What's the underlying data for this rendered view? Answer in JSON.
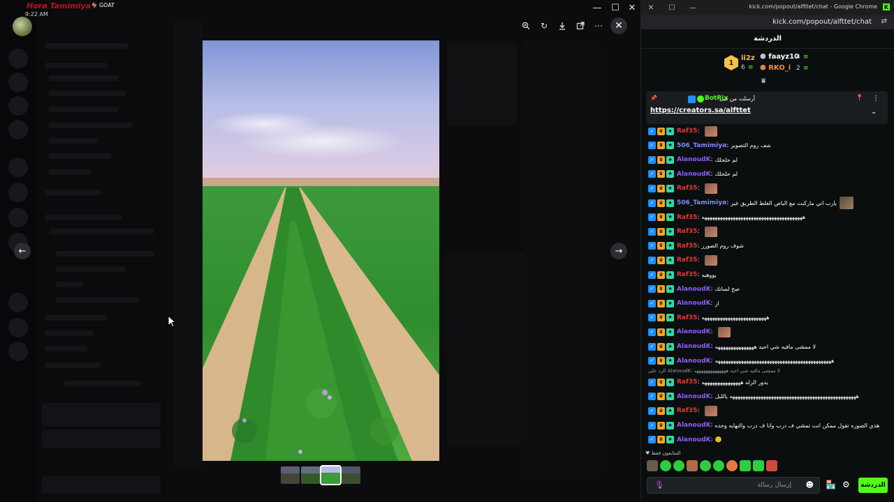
{
  "discord": {
    "viewer": {
      "username": "Hora Tamimiya",
      "badge": "GOAT",
      "time": "9:22 AM"
    },
    "window_controls": {
      "minimize": "—",
      "maximize": "☐",
      "close": "✕"
    },
    "toolbar_icons": [
      "zoom-in-icon",
      "rotate-icon",
      "download-icon",
      "open-external-icon",
      "more-icon"
    ],
    "thumbnails": 4,
    "active_thumbnail": 3
  },
  "chrome": {
    "title": "kick.com/popout/alfttet/chat - Google Chrome",
    "url": "kick.com/popout/alfttet/chat"
  },
  "chat": {
    "title": "الدردشة",
    "leaderboard": {
      "rank": "1",
      "first": {
        "name": "ii2z",
        "count": "6"
      },
      "second": {
        "name": "faayz10",
        "count": "4"
      },
      "third": {
        "name": "RKO_i",
        "count": "2"
      }
    },
    "pinned": {
      "by": "أرسلت من قبل",
      "user": "BotRix",
      "link": "https://creators.sa/alfttet"
    },
    "messages": [
      {
        "user": "Raf35",
        "color": "#e53935",
        "text": "",
        "emote": true
      },
      {
        "user": "506_Tamimiya",
        "color": "#7c8cff",
        "text": "شف روم التصوير"
      },
      {
        "user": "AlanoudK",
        "color": "#8e5cff",
        "text": "لم حلحلك"
      },
      {
        "user": "AlanoudK",
        "color": "#8e5cff",
        "text": "لم حلحلك"
      },
      {
        "user": "Raf35",
        "color": "#e53935",
        "text": "",
        "emote": true
      },
      {
        "user": "506_Tamimiya",
        "color": "#7c8cff",
        "text": "يارب اني ماركبت مع الباص الغلط الطريق غير",
        "emote": true
      },
      {
        "user": "Raf35",
        "color": "#e53935",
        "text": "هههههههههههههههههههههههههههههههههههههههه"
      },
      {
        "user": "Raf35",
        "color": "#e53935",
        "text": "",
        "emote": true
      },
      {
        "user": "Raf35",
        "color": "#e53935",
        "text": "شوف روم الصورر"
      },
      {
        "user": "Raf35",
        "color": "#e53935",
        "text": "",
        "emote": true
      },
      {
        "user": "Raf35",
        "color": "#e53935",
        "text": "يووهيه"
      },
      {
        "user": "AlanoudK",
        "color": "#8e5cff",
        "text": "صح لسانك"
      },
      {
        "user": "AlanoudK",
        "color": "#8e5cff",
        "text": "از"
      },
      {
        "user": "Raf35",
        "color": "#e53935",
        "text": "هههههههههههههههههههههههههه"
      },
      {
        "user": "AlanoudK",
        "color": "#8e5cff",
        "text": "",
        "emote": true
      },
      {
        "user": "AlanoudK",
        "color": "#8e5cff",
        "text": "لا ممشى مافيه شي احيد هههههههههههههههه"
      },
      {
        "user": "AlanoudK",
        "color": "#8e5cff",
        "text": "هههههههههههههههههههههههههههههههههههههههههههههه"
      },
      {
        "user": "Raf35",
        "color": "#e53935",
        "text": "يدور الزله هههههههههههههههه"
      },
      {
        "user": "AlanoudK",
        "color": "#8e5cff",
        "text": "هههههههههههههههههههههههههههههههههههههههههههههههههه يالليل"
      },
      {
        "user": "Raf35",
        "color": "#e53935",
        "text": "",
        "emote": true
      },
      {
        "user": "AlanoudK",
        "color": "#8e5cff",
        "text": "هذي الصوره تقول ممكن انت تمشي ف درب وانا ف درب والنهايه وحده"
      },
      {
        "user": "AlanoudK",
        "color": "#8e5cff",
        "text": "🙂"
      }
    ],
    "reply_note": "الرد على AlanoudK: لا ممشى مافيه شي احيد ههههههههههههههه",
    "chatters_label": "المتابعون فقط",
    "input_placeholder": "إرسال رسالة",
    "send_label": "الدردشة"
  },
  "colors": {
    "kick_green": "#53fc18",
    "discord_bg": "#0c0c0e",
    "chat_bg": "#0b0e0f"
  }
}
